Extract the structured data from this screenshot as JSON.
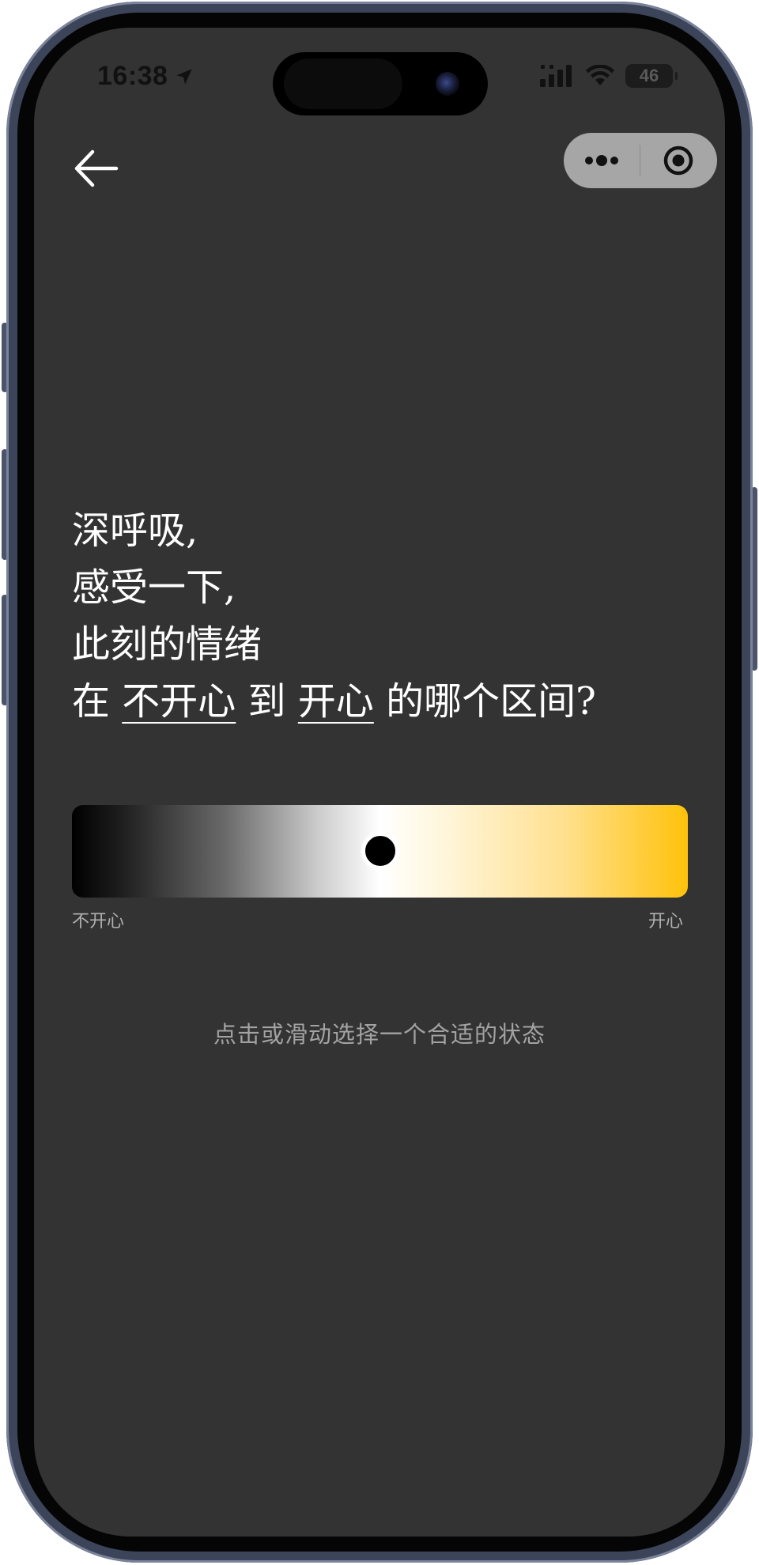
{
  "status_bar": {
    "time": "16:38",
    "battery": "46"
  },
  "nav": {
    "back_icon": "arrow-left-icon",
    "more_icon": "more-dots-icon",
    "close_icon": "target-circle-icon"
  },
  "question": {
    "line1": "深呼吸,",
    "line2": "感受一下,",
    "line3": "此刻的情绪",
    "line4_prefix": "在 ",
    "line4_unhappy": "不开心",
    "line4_mid": " 到 ",
    "line4_happy": "开心",
    "line4_suffix": " 的哪个区间?"
  },
  "mood_slider": {
    "min_label": "不开心",
    "max_label": "开心",
    "value": 0.5,
    "colors": {
      "start": "#000000",
      "middle": "#ffffff",
      "end": "#ffc20a"
    }
  },
  "hint": "点击或滑动选择一个合适的状态"
}
